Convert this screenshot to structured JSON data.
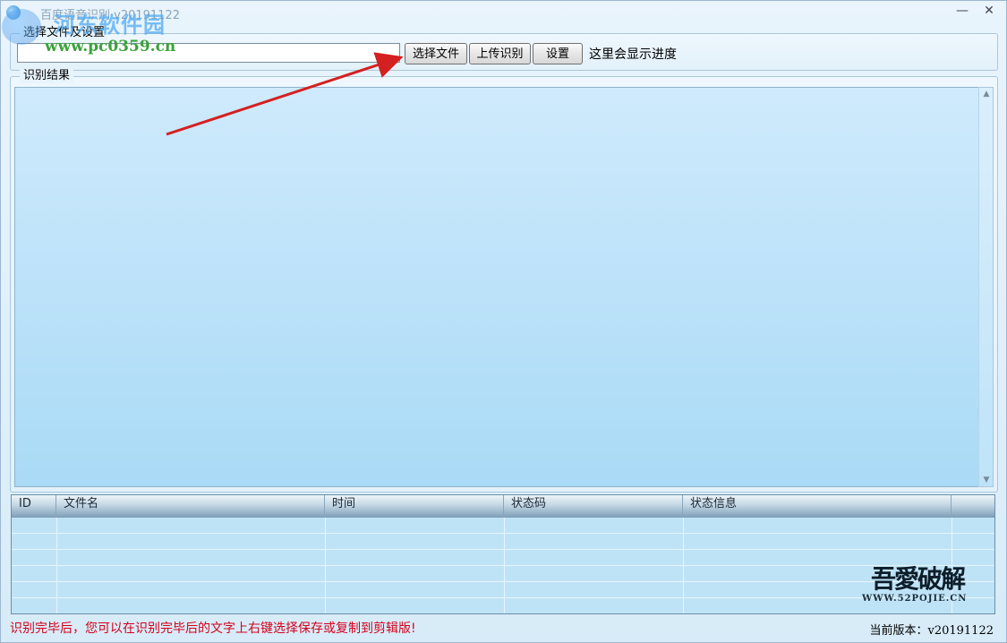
{
  "window": {
    "title": "百度语音识别 v20191122",
    "minimize_glyph": "—",
    "close_glyph": "✕",
    "icon": "app-globe-icon"
  },
  "watermark": {
    "title": "河东软件园",
    "url": "www.pc0359.cn"
  },
  "settings_group": {
    "label": "选择文件及设置",
    "file_path_value": "",
    "select_file_button": "选择文件",
    "upload_button": "上传识别",
    "settings_button": "设置",
    "progress_text": "这里会显示进度"
  },
  "result_group": {
    "label": "识别结果",
    "text": ""
  },
  "table": {
    "columns": [
      "ID",
      "文件名",
      "时间",
      "状态码",
      "状态信息",
      ""
    ],
    "rows": []
  },
  "stamp": {
    "mark": "吾愛破解",
    "url": "WWW.52POJIE.CN"
  },
  "status": {
    "hint": "识别完毕后，您可以在识别完毕后的文字上右键选择保存或复制到剪辑版!",
    "version_label": "当前版本：",
    "version_value": "v20191122"
  },
  "colors": {
    "hint": "#d6001c",
    "annotation_arrow": "#d42020"
  }
}
